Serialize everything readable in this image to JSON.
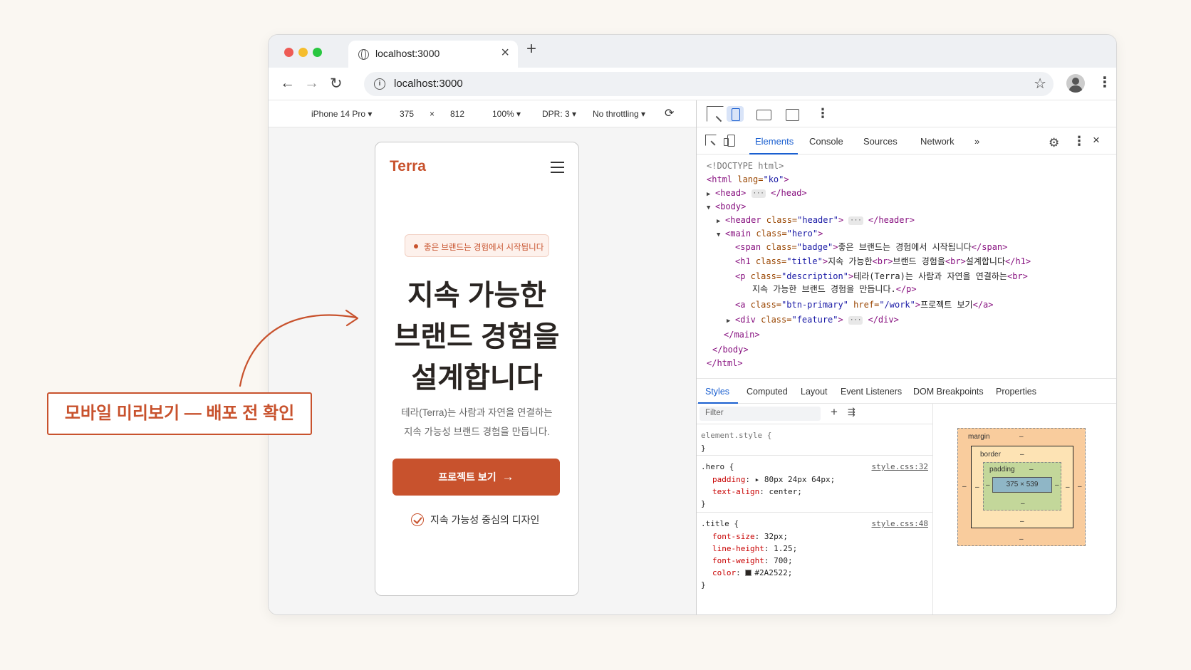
{
  "browser": {
    "tab_title": "localhost:3000",
    "url": "localhost:3000"
  },
  "device_toolbar": {
    "device": "iPhone 14 Pro ▾",
    "width": "375",
    "times": "×",
    "height": "812",
    "zoom": "100% ▾",
    "dpr": "DPR: 3 ▾",
    "throttle": "No throttling ▾"
  },
  "page": {
    "logo": "Terra",
    "badge": "좋은 브랜드는 경험에서 시작됩니다",
    "title_lines": [
      "지속 가능한",
      "브랜드 경험을",
      "설계합니다"
    ],
    "desc_lines": [
      "테라(Terra)는 사람과 자연을 연결하는",
      "지속 가능성 브랜드 경험을 만듭니다."
    ],
    "cta": "프로젝트 보기",
    "feature": "지속 가능성 중심의 디자인"
  },
  "devtools": {
    "tabs": [
      "Elements",
      "Console",
      "Sources",
      "Network",
      "»"
    ],
    "elements": {
      "doctype": "<!DOCTYPE html>",
      "html_open": "<html",
      "lang_attr": " lang=",
      "lang_val": "\"ko\"",
      "gt": ">",
      "head_open": "<head>",
      "ellipsis": "···",
      "head_close": "</head>",
      "body_open": "<body>",
      "header_open": "<header",
      "class_attr": " class=",
      "header_val": "\"header\"",
      "header_close": "</header>",
      "main_open": "<main",
      "main_val": "\"hero\"",
      "span_open": "<span",
      "span_val": "\"badge\"",
      "span_text": "좋은 브랜드는 경험에서 시작됩니다",
      "span_close": "</span>",
      "h1_open": "<h1",
      "h1_val": "\"title\"",
      "h1_text1": "지속 가능한",
      "br": "<br>",
      "h1_text2": "브랜드 경험을",
      "h1_text3": "설계합니다",
      "h1_close": "</h1>",
      "p_open": "<p",
      "p_val": "\"description\"",
      "p_text1": "테라(Terra)는 사람과 자연을 연결하는",
      "p_text2": "지속 가능한 브랜드 경험을 만듭니다.",
      "p_close": "</p>",
      "a_open": "<a",
      "a_val": "\"btn-primary\"",
      "href_attr": " href=",
      "href_val": "\"/work\"",
      "a_text": "프로젝트 보기",
      "a_close": "</a>",
      "div_open": "<div",
      "div_val": "\"feature\"",
      "div_close": "</div>",
      "main_close": "</main>",
      "body_close": "</body>",
      "html_close": "</html>"
    },
    "style_tabs": [
      "Styles",
      "Computed",
      "Layout",
      "Event Listeners",
      "DOM Breakpoints",
      "Properties"
    ],
    "filter_placeholder": "Filter",
    "rules": {
      "element_style": "element.style {",
      "brace_close": "}",
      "hero_sel": ".hero {",
      "hero_src": "style.css:32",
      "padding_name": "padding",
      "padding_val": ": ▸ 80px 24px 64px;",
      "textalign_name": "text-align",
      "textalign_val": ": center;",
      "title_sel": ".title {",
      "title_src": "style.css:48",
      "fs_name": "font-size",
      "fs_val": ": 32px;",
      "lh_name": "line-height",
      "lh_val": ": 1.25;",
      "fw_name": "font-weight",
      "fw_val": ": 700;",
      "color_name": "color",
      "color_sep": ": ",
      "color_val": "#2A2522;"
    },
    "box_model": {
      "margin": "margin",
      "border": "border",
      "padding": "padding",
      "content": "375 × 539",
      "dash": "–"
    }
  },
  "annotation": "모바일 미리보기 — 배포 전 확인",
  "colors": {
    "accent": "#c8522d",
    "title_text": "#2a2522",
    "devtools_active": "#1a5fd0"
  }
}
